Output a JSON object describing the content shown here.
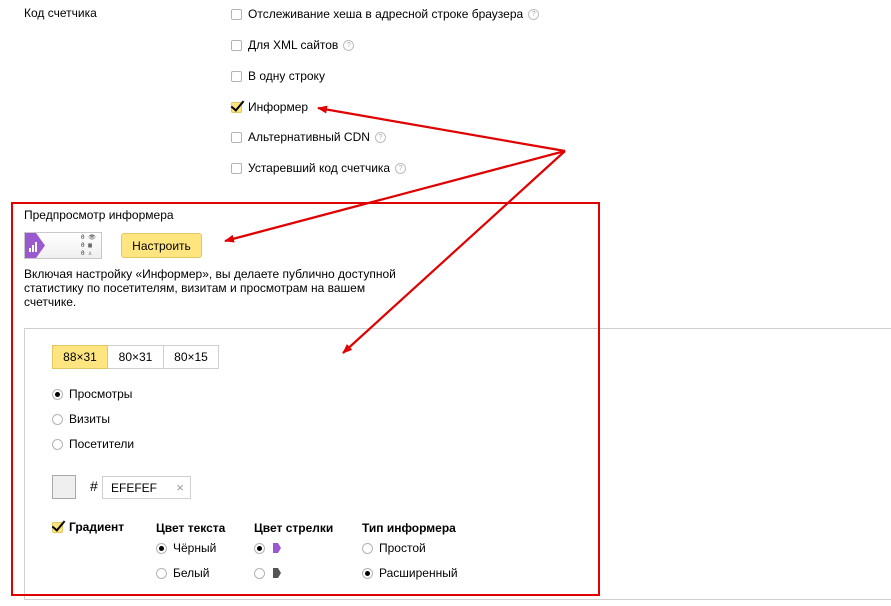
{
  "counter_code": {
    "label": "Код счетчика",
    "options": [
      {
        "label": "Отслеживание хеша в адресной строке браузера",
        "checked": false,
        "help": true
      },
      {
        "label": "Для XML сайтов",
        "checked": false,
        "help": true
      },
      {
        "label": "В одну строку",
        "checked": false,
        "help": false
      },
      {
        "label": "Информер",
        "checked": true,
        "help": false
      },
      {
        "label": "Альтернативный CDN",
        "checked": false,
        "help": true
      },
      {
        "label": "Устаревший код счетчика",
        "checked": false,
        "help": true
      }
    ]
  },
  "preview": {
    "title": "Предпросмотр информера",
    "configure_button": "Настроить",
    "description": "Включая настройку «Информер», вы делаете публично доступной статистику по посетителям, визитам и просмотрам на вашем счетчике.",
    "informer_stats": [
      "0",
      "0",
      "0"
    ]
  },
  "config": {
    "sizes": [
      {
        "label": "88×31",
        "active": true
      },
      {
        "label": "80×31",
        "active": false
      },
      {
        "label": "80×15",
        "active": false
      }
    ],
    "metrics": [
      {
        "label": "Просмотры",
        "selected": true
      },
      {
        "label": "Визиты",
        "selected": false
      },
      {
        "label": "Посетители",
        "selected": false
      }
    ],
    "color": {
      "hash": "#",
      "value": "EFEFEF",
      "clear": "×",
      "swatch": "#efefef"
    },
    "gradient": {
      "label": "Градиент",
      "checked": true
    },
    "text_color": {
      "title": "Цвет текста",
      "options": [
        {
          "label": "Чёрный",
          "selected": true
        },
        {
          "label": "Белый",
          "selected": false
        }
      ]
    },
    "arrow_color": {
      "title": "Цвет стрелки",
      "options": [
        {
          "icon": "purple-arrow-icon",
          "selected": true,
          "color": "#9b59d0"
        },
        {
          "icon": "dark-arrow-icon",
          "selected": false,
          "color": "#555555"
        }
      ]
    },
    "informer_type": {
      "title": "Тип информера",
      "options": [
        {
          "label": "Простой",
          "selected": false
        },
        {
          "label": "Расширенный",
          "selected": true
        }
      ]
    }
  },
  "colors": {
    "accent_yellow": "#ffe57f",
    "annotation_red": "#e00000",
    "arrow_purple": "#9b59d0"
  }
}
